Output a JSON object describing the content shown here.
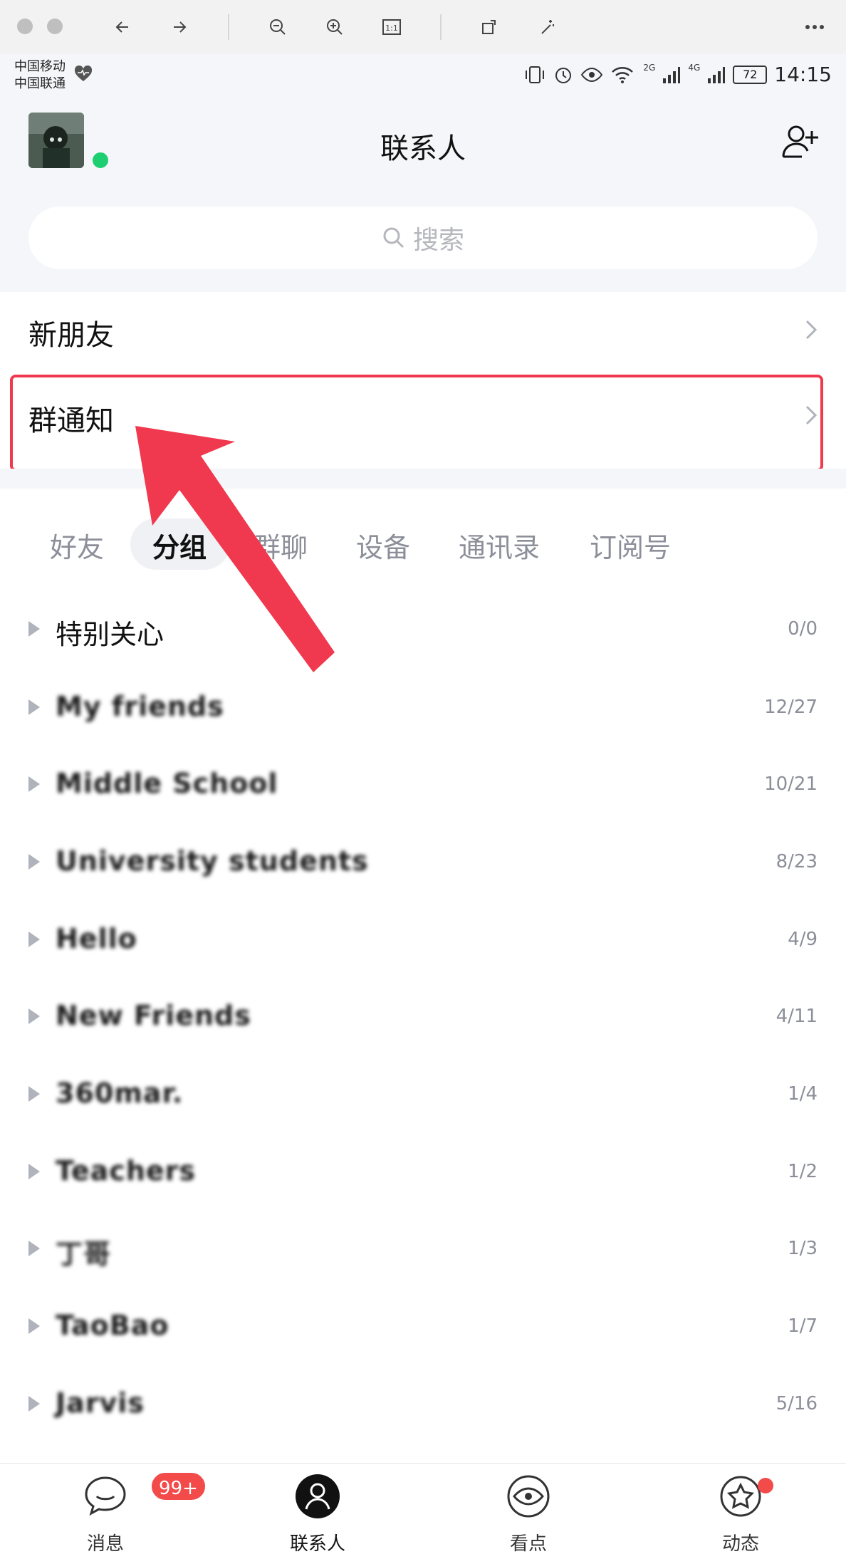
{
  "status_bar": {
    "carrier_1": "中国移动",
    "carrier_2": "中国联通",
    "signal_1": "2G",
    "signal_2": "4G",
    "battery": "72",
    "time": "14:15"
  },
  "header": {
    "title": "联系人",
    "search_placeholder": "搜索"
  },
  "menu": {
    "new_friends": "新朋友",
    "group_notice": "群通知"
  },
  "tabs": [
    {
      "label": "好友",
      "active": false
    },
    {
      "label": "分组",
      "active": true
    },
    {
      "label": "群聊",
      "active": false
    },
    {
      "label": "设备",
      "active": false
    },
    {
      "label": "通讯录",
      "active": false
    },
    {
      "label": "订阅号",
      "active": false
    }
  ],
  "groups": [
    {
      "name": "特别关心",
      "count": "0/0"
    },
    {
      "name": "My friends",
      "count": "12/27"
    },
    {
      "name": "Middle School",
      "count": "10/21"
    },
    {
      "name": "University students",
      "count": "8/23"
    },
    {
      "name": "Hello",
      "count": "4/9"
    },
    {
      "name": "New Friends",
      "count": "4/11"
    },
    {
      "name": "360mar.",
      "count": "1/4"
    },
    {
      "name": "Teachers",
      "count": "1/2"
    },
    {
      "name": "丁哥",
      "count": "1/3"
    },
    {
      "name": "TaoBao",
      "count": "1/7"
    },
    {
      "name": "Jarvis",
      "count": "5/16"
    }
  ],
  "bottom_nav": {
    "messages": "消息",
    "messages_badge": "99+",
    "contacts": "联系人",
    "discover": "看点",
    "moments": "动态"
  },
  "colors": {
    "accent_red": "#f0384e",
    "online_green": "#1ecf72",
    "background_gray": "#f5f6fa"
  }
}
